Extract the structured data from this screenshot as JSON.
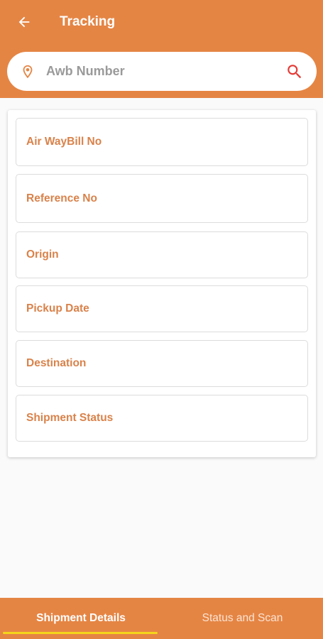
{
  "header": {
    "title": "Tracking",
    "back_icon": "arrow-left-icon"
  },
  "search": {
    "placeholder": "Awb Number",
    "value": "",
    "leading_icon": "location-pin-icon",
    "trailing_icon": "search-icon"
  },
  "fields": [
    {
      "label": "Air WayBill No"
    },
    {
      "label": "Reference No"
    },
    {
      "label": "Origin"
    },
    {
      "label": "Pickup Date"
    },
    {
      "label": "Destination"
    },
    {
      "label": "Shipment Status"
    }
  ],
  "bottom_nav": {
    "tabs": [
      {
        "label": "Shipment Details",
        "active": true
      },
      {
        "label": "Status and Scan",
        "active": false
      }
    ]
  },
  "colors": {
    "primary": "#e58544",
    "field_label": "#d9824a",
    "search_icon": "#e53935",
    "tab_indicator": "#f5d51a",
    "background": "#fafafa"
  }
}
